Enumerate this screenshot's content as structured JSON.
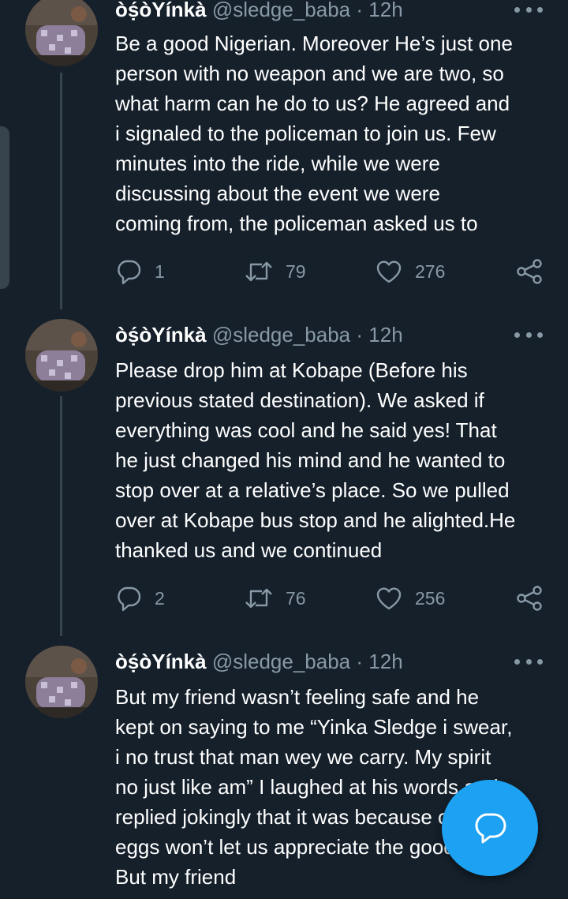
{
  "tweets": [
    {
      "author_name": "òṣ́òYínkà",
      "handle": "@sledge_baba",
      "separator": "·",
      "time": "12h",
      "text": "Be a good Nigerian. Moreover He’s just one\nperson with no weapon and we are two, so\nwhat harm can he do to us? He agreed and\ni signaled to the policeman to join us. Few\nminutes into the ride, while we were\ndiscussing about the event we were\ncoming from, the policeman asked us to",
      "replies": "1",
      "retweets": "79",
      "likes": "276"
    },
    {
      "author_name": "òṣ́òYínkà",
      "handle": "@sledge_baba",
      "separator": "·",
      "time": "12h",
      "text": "Please drop him at Kobape (Before his\nprevious stated destination). We asked if\neverything was cool and he said yes! That\nhe just changed his mind and he wanted to\nstop over at a relative’s place. So we pulled\nover at Kobape bus stop and he alighted.He\nthanked us and we continued",
      "replies": "2",
      "retweets": "76",
      "likes": "256"
    },
    {
      "author_name": "òṣ́òYínkà",
      "handle": "@sledge_baba",
      "separator": "·",
      "time": "12h",
      "text": "But my friend wasn’t feeling safe and he\nkept on saying to me “Yinka Sledge i swear,\ni no trust that man wey we carry. My spirit\nno just like am” I laughed at his words and\nreplied jokingly that it was because our\neggs won’t let us appreciate the good deed.\nBut my friend"
    }
  ],
  "icons": {
    "reply": "reply-icon",
    "retweet": "retweet-icon",
    "like": "like-icon",
    "share": "share-icon",
    "more": "more-options-icon",
    "compose": "compose-reply-icon"
  },
  "colors": {
    "background": "#15202b",
    "text_primary": "#ffffff",
    "text_secondary": "#8899a6",
    "accent": "#1da1f2",
    "thread_line": "#38444d"
  }
}
